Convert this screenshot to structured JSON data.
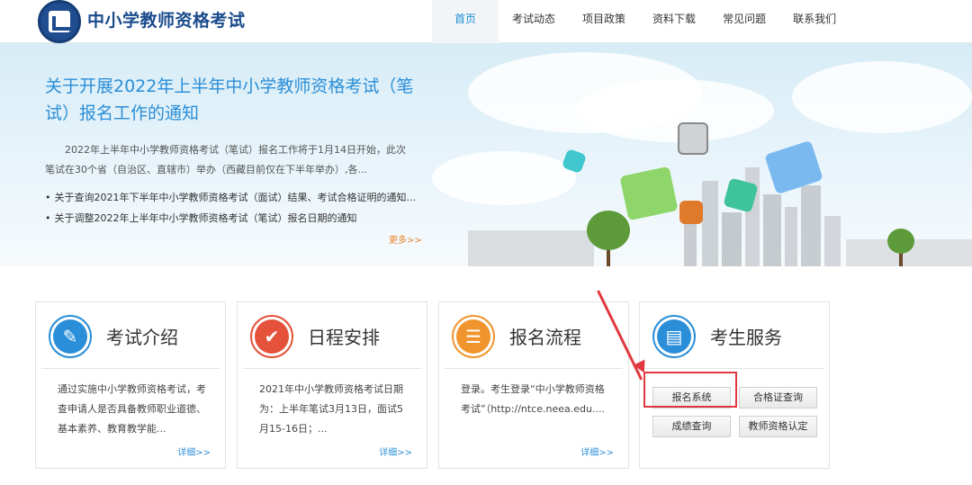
{
  "header": {
    "site_title": "中小学教师资格考试",
    "nav": [
      "首页",
      "考试动态",
      "项目政策",
      "资料下载",
      "常见问题",
      "联系我们"
    ],
    "active_nav": "首页"
  },
  "banner": {
    "title": "关于开展2022年上半年中小学教师资格考试（笔试）报名工作的通知",
    "description": "2022年上半年中小学教师资格考试（笔试）报名工作将于1月14日开始，此次笔试在30个省（自治区、直辖市）举办（西藏目前仅在下半年举办）,各...",
    "links": [
      "关于查询2021年下半年中小学教师资格考试（面试）结果、考试合格证明的通知...",
      "关于调整2022年上半年中小学教师资格考试（笔试）报名日期的通知"
    ],
    "more": "更多>>"
  },
  "cards": [
    {
      "title": "考试介绍",
      "icon": "document-edit-icon",
      "text": "通过实施中小学教师资格考试，考查申请人是否具备教师职业道德、基本素养、教育教学能...",
      "more": "详细>>",
      "color": "#2a8ed8"
    },
    {
      "title": "日程安排",
      "icon": "checkmark-icon",
      "text": "2021年中小学教师资格考试日期为：上半年笔试3月13日，面试5月15-16日；...",
      "more": "详细>>",
      "color": "#e4523b"
    },
    {
      "title": "报名流程",
      "icon": "form-pen-icon",
      "text": "登录。考生登录“中小学教师资格考试”（http://ntce.neea.edu....",
      "more": "详细>>",
      "color": "#f0952e"
    },
    {
      "title": "考生服务",
      "icon": "contact-book-icon",
      "buttons": [
        "报名系统",
        "合格证查询",
        "成绩查询",
        "教师资格认定"
      ],
      "color": "#2a8ed8"
    }
  ]
}
